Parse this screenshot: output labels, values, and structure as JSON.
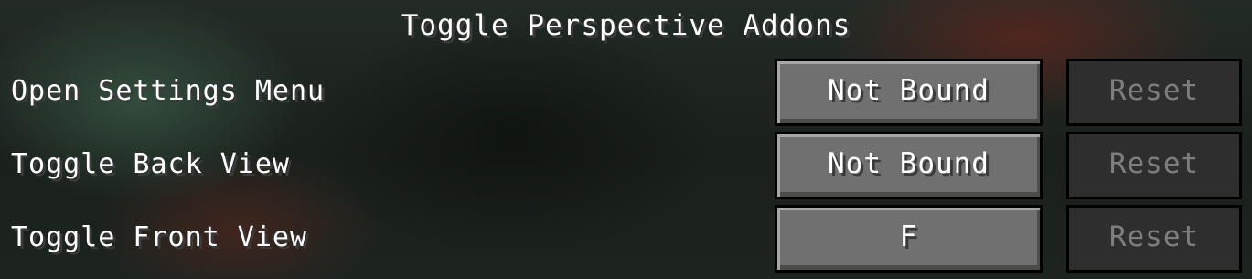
{
  "screen": {
    "title": "Toggle Perspective Addons"
  },
  "keybinds": [
    {
      "action": "Open Settings Menu",
      "key": "Not Bound",
      "reset_label": "Reset"
    },
    {
      "action": "Toggle Back View",
      "key": "Not Bound",
      "reset_label": "Reset"
    },
    {
      "action": "Toggle Front View",
      "key": "F",
      "reset_label": "Reset"
    }
  ]
}
